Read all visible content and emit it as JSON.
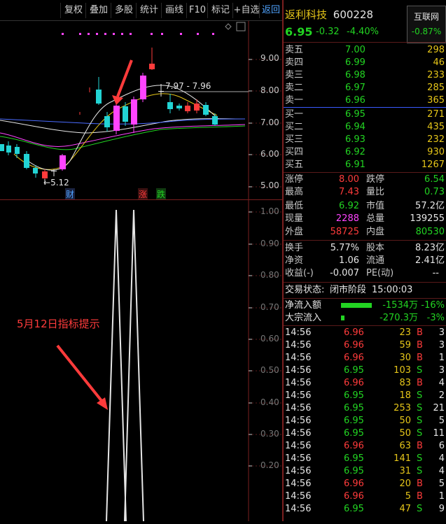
{
  "toolbar": {
    "buttons": [
      "复权",
      "叠加",
      "多股",
      "统计",
      "画线",
      "F10",
      "标记",
      "+自选",
      "返回"
    ]
  },
  "stock": {
    "name": "返利科技",
    "code": "600228",
    "price": "6.95",
    "change": "-0.32",
    "change_pct": "-4.40%",
    "sector": "互联网",
    "sector_pct": "-0.87%"
  },
  "asks": [
    {
      "label": "卖五",
      "price": "7.00",
      "vol": "298"
    },
    {
      "label": "卖四",
      "price": "6.99",
      "vol": "46"
    },
    {
      "label": "卖三",
      "price": "6.98",
      "vol": "233"
    },
    {
      "label": "卖二",
      "price": "6.97",
      "vol": "285"
    },
    {
      "label": "卖一",
      "price": "6.96",
      "vol": "365"
    }
  ],
  "bids": [
    {
      "label": "买一",
      "price": "6.95",
      "vol": "271"
    },
    {
      "label": "买二",
      "price": "6.94",
      "vol": "435"
    },
    {
      "label": "买三",
      "price": "6.93",
      "vol": "232"
    },
    {
      "label": "买四",
      "price": "6.92",
      "vol": "930"
    },
    {
      "label": "买五",
      "price": "6.91",
      "vol": "1267"
    }
  ],
  "stats": {
    "zhangting_label": "涨停",
    "zhangting": "8.00",
    "dieting_label": "跌停",
    "dieting": "6.54",
    "high_label": "最高",
    "high": "7.43",
    "liangbi_label": "量比",
    "liangbi": "0.73",
    "low_label": "最低",
    "low": "6.92",
    "shizhi_label": "市值",
    "shizhi": "57.2亿",
    "xianliang_label": "现量",
    "xianliang": "2288",
    "zongliang_label": "总量",
    "zongliang": "139255",
    "waipan_label": "外盘",
    "waipan": "58725",
    "neipan_label": "内盘",
    "neipan": "80530",
    "huanshou_label": "换手",
    "huanshou": "5.77%",
    "guben_label": "股本",
    "guben": "8.23亿",
    "jingzi_label": "净资",
    "jingzi": "1.06",
    "liutong_label": "流通",
    "liutong": "2.41亿",
    "shouyi_label": "收益(-)",
    "shouyi": "-0.007",
    "pe_label": "PE(动)",
    "pe": "--"
  },
  "status": {
    "label": "交易状态:",
    "stage": "闭市阶段",
    "time": "15:00:03"
  },
  "flows": [
    {
      "label": "净流入额",
      "amount": "-1534万",
      "pct": "-16%",
      "bar_fraction": 0.95
    },
    {
      "label": "大宗流入",
      "amount": "-270.3万",
      "pct": "-3%",
      "bar_fraction": 0.1
    }
  ],
  "ticks": [
    {
      "time": "14:56",
      "price": "6.96",
      "vol": "23",
      "side": "B",
      "n": "3"
    },
    {
      "time": "14:56",
      "price": "6.96",
      "vol": "59",
      "side": "B",
      "n": "3"
    },
    {
      "time": "14:56",
      "price": "6.96",
      "vol": "30",
      "side": "B",
      "n": "1"
    },
    {
      "time": "14:56",
      "price": "6.95",
      "vol": "103",
      "side": "S",
      "n": "3"
    },
    {
      "time": "14:56",
      "price": "6.96",
      "vol": "83",
      "side": "B",
      "n": "4"
    },
    {
      "time": "14:56",
      "price": "6.95",
      "vol": "18",
      "side": "S",
      "n": "2"
    },
    {
      "time": "14:56",
      "price": "6.95",
      "vol": "253",
      "side": "S",
      "n": "21"
    },
    {
      "time": "14:56",
      "price": "6.95",
      "vol": "50",
      "side": "S",
      "n": "5"
    },
    {
      "time": "14:56",
      "price": "6.95",
      "vol": "50",
      "side": "S",
      "n": "11"
    },
    {
      "time": "14:56",
      "price": "6.96",
      "vol": "63",
      "side": "B",
      "n": "6"
    },
    {
      "time": "14:56",
      "price": "6.95",
      "vol": "141",
      "side": "S",
      "n": "4"
    },
    {
      "time": "14:56",
      "price": "6.95",
      "vol": "31",
      "side": "S",
      "n": "4"
    },
    {
      "time": "14:56",
      "price": "6.96",
      "vol": "20",
      "side": "B",
      "n": "5"
    },
    {
      "time": "14:56",
      "price": "6.96",
      "vol": "5",
      "side": "B",
      "n": "1"
    },
    {
      "time": "14:56",
      "price": "6.95",
      "vol": "47",
      "side": "S",
      "n": "9"
    }
  ],
  "kline": {
    "y_ticks": [
      "9.00",
      "8.00",
      "7.00",
      "6.00",
      "5.00"
    ],
    "range_label": "7.97 - 7.96",
    "low_label": "5.12",
    "markers": [
      "财",
      "涨",
      "跌"
    ]
  },
  "indicator": {
    "y_ticks": [
      "1.00",
      "0.90",
      "0.80",
      "0.70",
      "0.60",
      "0.50",
      "0.40",
      "0.30",
      "0.20"
    ],
    "annotation": "5月12日指标提示"
  },
  "colors": {
    "up": "#ff3b3b",
    "down": "#22d4d4",
    "indicator_up": "#ff44ff",
    "accent_red": "#ff3b3b"
  }
}
